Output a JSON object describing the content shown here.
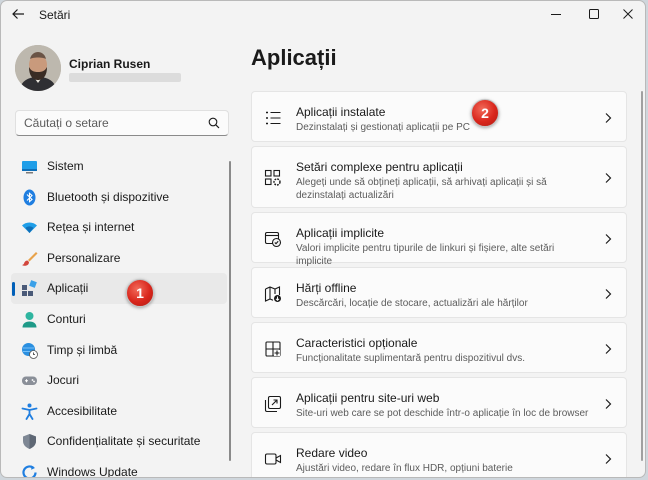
{
  "window": {
    "title": "Setări"
  },
  "profile": {
    "name": "Ciprian Rusen"
  },
  "search": {
    "placeholder": "Căutați o setare"
  },
  "sidebar": {
    "items": [
      {
        "label": "Sistem",
        "icon": "monitor-icon",
        "selected": false
      },
      {
        "label": "Bluetooth și dispozitive",
        "icon": "bluetooth-icon",
        "selected": false
      },
      {
        "label": "Rețea și internet",
        "icon": "wifi-icon",
        "selected": false
      },
      {
        "label": "Personalizare",
        "icon": "brush-icon",
        "selected": false
      },
      {
        "label": "Aplicații",
        "icon": "apps-icon",
        "selected": true
      },
      {
        "label": "Conturi",
        "icon": "person-icon",
        "selected": false
      },
      {
        "label": "Timp și limbă",
        "icon": "globe-clock-icon",
        "selected": false
      },
      {
        "label": "Jocuri",
        "icon": "gamepad-icon",
        "selected": false
      },
      {
        "label": "Accesibilitate",
        "icon": "accessibility-icon",
        "selected": false
      },
      {
        "label": "Confidențialitate și securitate",
        "icon": "shield-icon",
        "selected": false
      },
      {
        "label": "Windows Update",
        "icon": "update-icon",
        "selected": false
      }
    ]
  },
  "main": {
    "title": "Aplicații",
    "cards": [
      {
        "title": "Aplicații instalate",
        "desc": "Dezinstalați și gestionați aplicații pe PC",
        "icon": "list-icon"
      },
      {
        "title": "Setări complexe pentru aplicații",
        "desc": "Alegeți unde să obțineți aplicații, să arhivați aplicații și să dezinstalați actualizări",
        "icon": "advanced-apps-icon"
      },
      {
        "title": "Aplicații implicite",
        "desc": "Valori implicite pentru tipurile de linkuri și fișiere, alte setări implicite",
        "icon": "default-apps-icon"
      },
      {
        "title": "Hărți offline",
        "desc": "Descărcări, locație de stocare, actualizări ale hărților",
        "icon": "map-icon"
      },
      {
        "title": "Caracteristici opționale",
        "desc": "Funcționalitate suplimentară pentru dispozitivul dvs.",
        "icon": "add-feature-icon"
      },
      {
        "title": "Aplicații pentru site-uri web",
        "desc": "Site-uri web care se pot deschide într-o aplicație în loc de browser",
        "icon": "open-in-app-icon"
      },
      {
        "title": "Redare video",
        "desc": "Ajustări video, redare în flux HDR, opțiuni baterie",
        "icon": "video-icon"
      }
    ]
  },
  "annotations": {
    "badge1": "1",
    "badge2": "2"
  },
  "colors": {
    "accent": "#005fb8",
    "badge": "#d9261c"
  }
}
